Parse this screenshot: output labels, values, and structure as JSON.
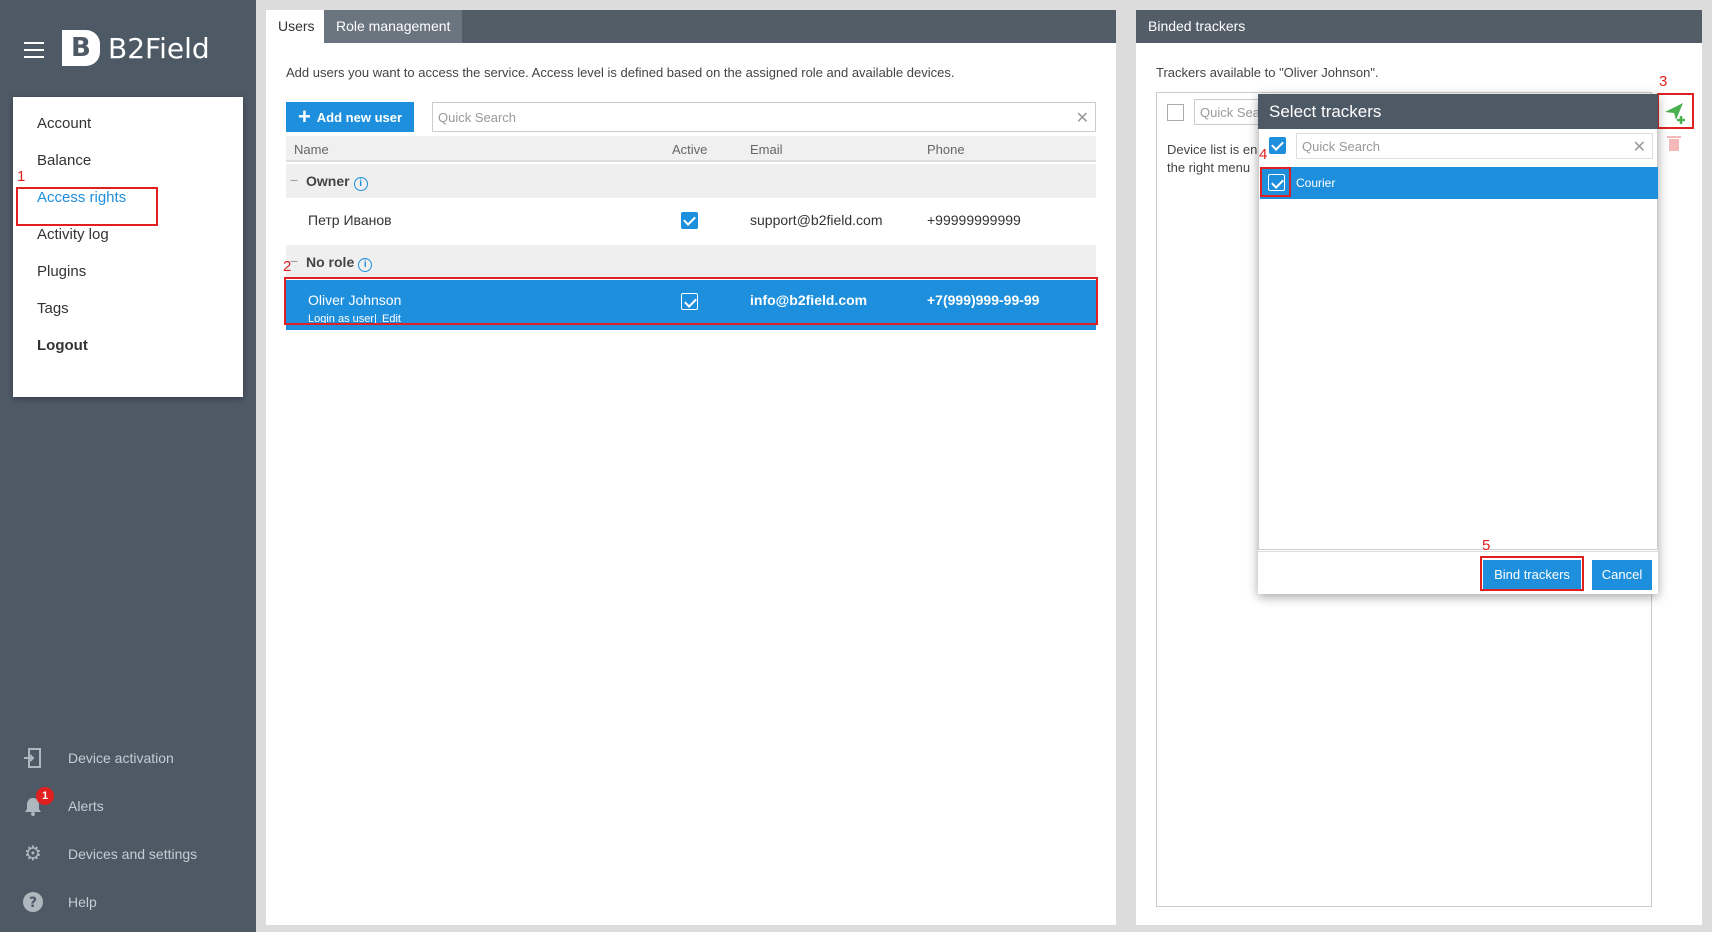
{
  "app": {
    "name": "B2Field"
  },
  "sidebar": {
    "menu": [
      {
        "label": "Account"
      },
      {
        "label": "Balance"
      },
      {
        "label": "Access rights"
      },
      {
        "label": "Activity log"
      },
      {
        "label": "Plugins"
      },
      {
        "label": "Tags"
      },
      {
        "label": "Logout"
      }
    ],
    "bottom": [
      {
        "label": "Device activation",
        "icon": "device-activation-icon"
      },
      {
        "label": "Alerts",
        "icon": "bell-icon",
        "badge": "1"
      },
      {
        "label": "Devices and settings",
        "icon": "gear-icon"
      },
      {
        "label": "Help",
        "icon": "help-icon"
      }
    ]
  },
  "users_panel": {
    "tabs": [
      {
        "label": "Users"
      },
      {
        "label": "Role management"
      }
    ],
    "description": "Add users you want to access the service. Access level is defined based on the assigned role and available devices.",
    "add_button": "Add new user",
    "search_placeholder": "Quick Search",
    "columns": {
      "name": "Name",
      "active": "Active",
      "email": "Email",
      "phone": "Phone"
    },
    "groups": [
      {
        "name": "Owner",
        "users": [
          {
            "name": "Петр Иванов",
            "active": true,
            "email": "support@b2field.com",
            "phone": "+99999999999"
          }
        ]
      },
      {
        "name": "No role",
        "users": [
          {
            "name": "Oliver Johnson",
            "active": true,
            "email": "info@b2field.com",
            "phone": "+7(999)999-99-99",
            "links": {
              "login": "Login as user",
              "sep": "|",
              "edit": "Edit"
            }
          }
        ]
      }
    ]
  },
  "bind_panel": {
    "title": "Binded trackers",
    "description": "Trackers available to \"Oliver Johnson\".",
    "search_placeholder_partial": "Quick Sea",
    "empty_line1": "Device list is en",
    "empty_line2": "the right menu"
  },
  "modal": {
    "title": "Select trackers",
    "search_placeholder": "Quick Search",
    "items": [
      {
        "label": "Courier",
        "checked": true
      }
    ],
    "bind_button": "Bind trackers",
    "cancel_button": "Cancel"
  },
  "annotations": [
    "1",
    "2",
    "3",
    "4",
    "5"
  ],
  "colors": {
    "accent": "#1e8fdc",
    "sidebar": "#4d5965",
    "annotation": "#e02020"
  }
}
